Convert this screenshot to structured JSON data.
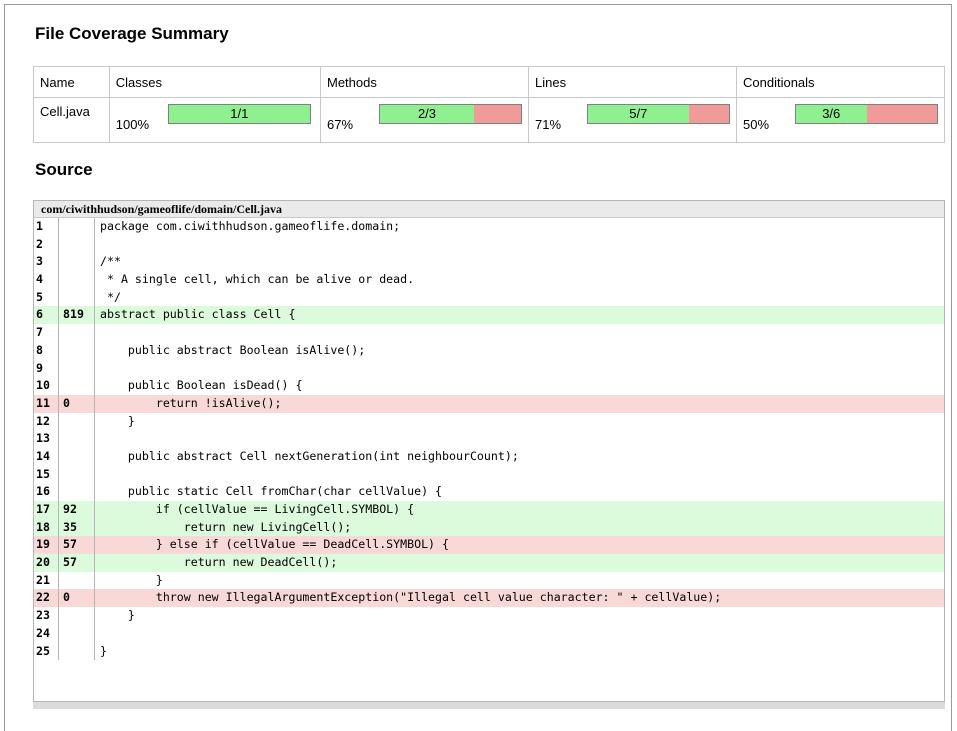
{
  "summary": {
    "title": "File Coverage Summary",
    "headers": [
      "Name",
      "Classes",
      "Methods",
      "Lines",
      "Conditionals"
    ],
    "file_name": "Cell.java",
    "metrics": [
      {
        "key": "classes",
        "percent": "100%",
        "ratio": "1/1",
        "fraction": 1.0
      },
      {
        "key": "methods",
        "percent": "67%",
        "ratio": "2/3",
        "fraction": 0.6667
      },
      {
        "key": "lines",
        "percent": "71%",
        "ratio": "5/7",
        "fraction": 0.7143
      },
      {
        "key": "conditionals",
        "percent": "50%",
        "ratio": "3/6",
        "fraction": 0.5
      }
    ],
    "colors": {
      "covered": "#8ef08e",
      "uncovered": "#f19a9a"
    }
  },
  "source": {
    "title": "Source",
    "path": "com/ciwithhudson/gameoflife/domain/Cell.java",
    "colors": {
      "covered_line": "#dcfadc",
      "missed_line": "#f9d8d8"
    },
    "lines": [
      {
        "n": "1",
        "hits": "",
        "code": "package com.ciwithhudson.gameoflife.domain;",
        "status": ""
      },
      {
        "n": "2",
        "hits": "",
        "code": "",
        "status": ""
      },
      {
        "n": "3",
        "hits": "",
        "code": "/**",
        "status": ""
      },
      {
        "n": "4",
        "hits": "",
        "code": " * A single cell, which can be alive or dead.",
        "status": ""
      },
      {
        "n": "5",
        "hits": "",
        "code": " */",
        "status": ""
      },
      {
        "n": "6",
        "hits": "819",
        "code": "abstract public class Cell {",
        "status": "covered"
      },
      {
        "n": "7",
        "hits": "",
        "code": "",
        "status": ""
      },
      {
        "n": "8",
        "hits": "",
        "code": "    public abstract Boolean isAlive();",
        "status": ""
      },
      {
        "n": "9",
        "hits": "",
        "code": "",
        "status": ""
      },
      {
        "n": "10",
        "hits": "",
        "code": "    public Boolean isDead() {",
        "status": ""
      },
      {
        "n": "11",
        "hits": "0",
        "code": "        return !isAlive();",
        "status": "missed"
      },
      {
        "n": "12",
        "hits": "",
        "code": "    }",
        "status": ""
      },
      {
        "n": "13",
        "hits": "",
        "code": "",
        "status": ""
      },
      {
        "n": "14",
        "hits": "",
        "code": "    public abstract Cell nextGeneration(int neighbourCount);",
        "status": ""
      },
      {
        "n": "15",
        "hits": "",
        "code": "",
        "status": ""
      },
      {
        "n": "16",
        "hits": "",
        "code": "    public static Cell fromChar(char cellValue) {",
        "status": ""
      },
      {
        "n": "17",
        "hits": "92",
        "code": "        if (cellValue == LivingCell.SYMBOL) {",
        "status": "covered"
      },
      {
        "n": "18",
        "hits": "35",
        "code": "            return new LivingCell();",
        "status": "covered"
      },
      {
        "n": "19",
        "hits": "57",
        "code": "        } else if (cellValue == DeadCell.SYMBOL) {",
        "status": "missed"
      },
      {
        "n": "20",
        "hits": "57",
        "code": "            return new DeadCell();",
        "status": "covered"
      },
      {
        "n": "21",
        "hits": "",
        "code": "        }",
        "status": ""
      },
      {
        "n": "22",
        "hits": "0",
        "code": "        throw new IllegalArgumentException(\"Illegal cell value character: \" + cellValue);",
        "status": "missed"
      },
      {
        "n": "23",
        "hits": "",
        "code": "    }",
        "status": ""
      },
      {
        "n": "24",
        "hits": "",
        "code": "",
        "status": ""
      },
      {
        "n": "25",
        "hits": "",
        "code": "}",
        "status": ""
      }
    ]
  }
}
